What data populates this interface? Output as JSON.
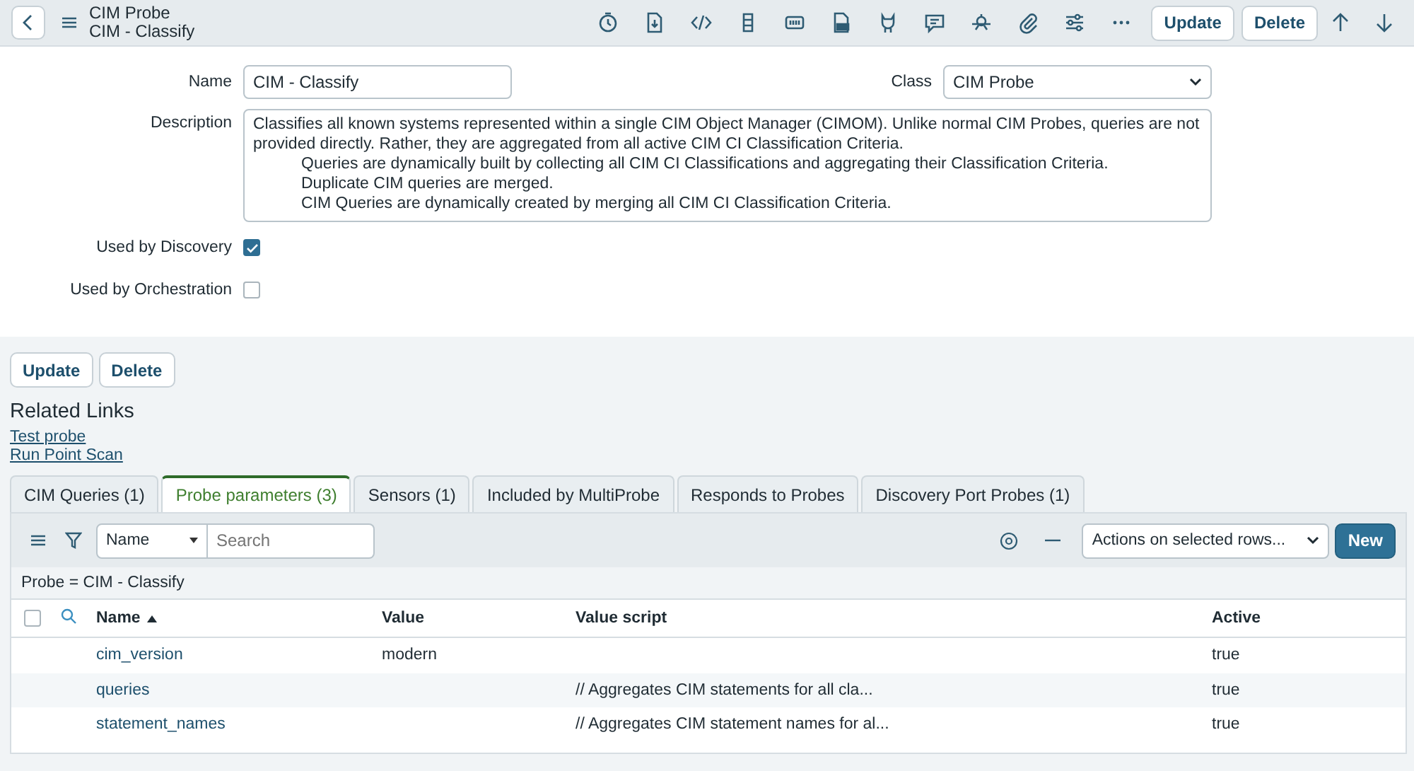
{
  "header": {
    "title": "CIM Probe",
    "subtitle": "CIM - Classify",
    "buttons": [
      "Update",
      "Delete"
    ]
  },
  "form": {
    "name_label": "Name",
    "name_value": "CIM - Classify",
    "class_label": "Class",
    "class_value": "CIM Probe",
    "description_label": "Description",
    "description_lines": [
      {
        "kind": "plain",
        "text": "Classifies all known systems represented within a single CIM Object Manager (CIMOM).  Unlike normal CIM Probes, queries are not"
      },
      {
        "kind": "plain",
        "text": "provided directly. Rather, they are aggregated from all active CIM CI Classification Criteria."
      },
      {
        "kind": "indented",
        "text": "Queries are dynamically built by collecting all CIM CI Classifications and aggregating their Classification Criteria."
      },
      {
        "kind": "indented",
        "text": "Duplicate CIM queries are merged."
      },
      {
        "kind": "indented",
        "text": "CIM Queries are dynamically created by merging all CIM CI Classification Criteria."
      }
    ],
    "checkboxes": [
      {
        "label": "Used by Discovery",
        "checked": true
      },
      {
        "label": "Used by Orchestration",
        "checked": false
      }
    ]
  },
  "form_buttons": [
    "Update",
    "Delete"
  ],
  "related_links": {
    "title": "Related Links",
    "links": [
      "Test probe",
      "Run Point Scan"
    ]
  },
  "tabs": [
    {
      "label": "CIM Queries (1)",
      "selected": false
    },
    {
      "label": "Probe parameters (3)",
      "selected": true
    },
    {
      "label": "Sensors (1)",
      "selected": false
    },
    {
      "label": "Included by MultiProbe",
      "selected": false
    },
    {
      "label": "Responds to Probes",
      "selected": false
    },
    {
      "label": "Discovery Port Probes (1)",
      "selected": false
    }
  ],
  "list": {
    "search_field": "Name",
    "search_placeholder": "Search",
    "actions": "Actions on selected rows...",
    "new_button": "New",
    "filter": "Probe = CIM - Classify",
    "select_all": {
      "checked": false
    },
    "columns": [
      "Name",
      "Value",
      "Value script",
      "Active"
    ],
    "rows": [
      {
        "name": "cim_version",
        "value": "modern",
        "value_script": "",
        "active": "true"
      },
      {
        "name": "queries",
        "value": "",
        "value_script": "// Aggregates CIM statements for all cla...",
        "active": "true"
      },
      {
        "name": "statement_names",
        "value": "",
        "value_script": "// Aggregates CIM statement names for al...",
        "active": "true"
      }
    ]
  }
}
